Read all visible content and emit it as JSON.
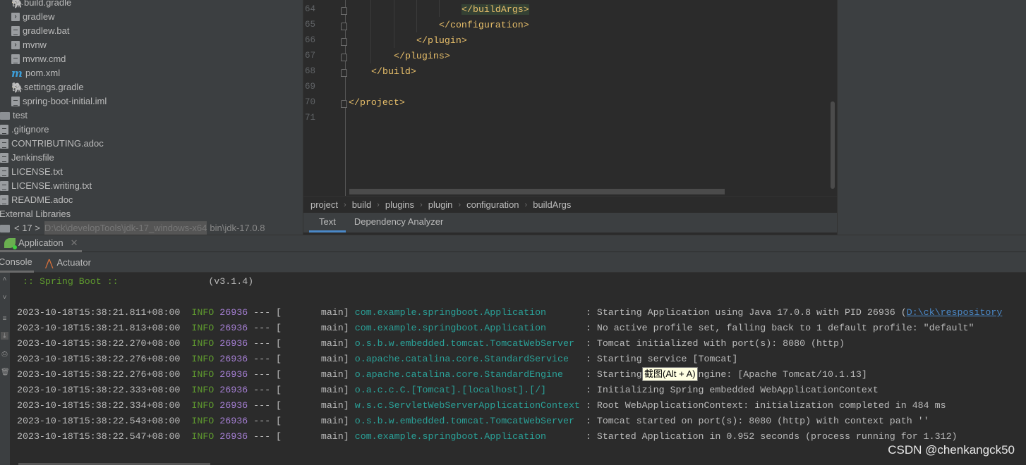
{
  "project_tree": [
    {
      "label": "build.gradle",
      "icon": "gradle-icon",
      "indent": 1
    },
    {
      "label": "gradlew",
      "icon": "executable-icon",
      "indent": 1
    },
    {
      "label": "gradlew.bat",
      "icon": "text-file-icon",
      "indent": 1
    },
    {
      "label": "mvnw",
      "icon": "executable-icon",
      "indent": 1
    },
    {
      "label": "mvnw.cmd",
      "icon": "text-file-icon",
      "indent": 1
    },
    {
      "label": "pom.xml",
      "icon": "maven-icon",
      "indent": 1
    },
    {
      "label": "settings.gradle",
      "icon": "gradle-icon",
      "indent": 1
    },
    {
      "label": "spring-boot-initial.iml",
      "icon": "module-file-icon",
      "indent": 1
    },
    {
      "label": "test",
      "icon": "folder-icon",
      "indent": 0
    },
    {
      "label": ".gitignore",
      "icon": "ignore-file-icon",
      "indent": 0
    },
    {
      "label": "CONTRIBUTING.adoc",
      "icon": "text-file-icon",
      "indent": 0
    },
    {
      "label": "Jenkinsfile",
      "icon": "text-file-icon",
      "indent": 0
    },
    {
      "label": "LICENSE.txt",
      "icon": "text-file-icon",
      "indent": 0
    },
    {
      "label": "LICENSE.writing.txt",
      "icon": "text-file-icon",
      "indent": 0
    },
    {
      "label": "README.adoc",
      "icon": "text-file-icon",
      "indent": 0
    },
    {
      "label": "External Libraries",
      "icon": "",
      "indent": -1
    }
  ],
  "jdk_row": {
    "name": "< 17 >",
    "path": "D:\\ck\\developTools\\jdk-17_windows-x64",
    "suffix": "bin\\jdk-17.0.8"
  },
  "editor": {
    "lines": [
      {
        "num": "64",
        "text": "</buildArgs>",
        "indent": 5,
        "highlight": true
      },
      {
        "num": "65",
        "text": "</configuration>",
        "indent": 4
      },
      {
        "num": "66",
        "text": "</plugin>",
        "indent": 3
      },
      {
        "num": "67",
        "text": "</plugins>",
        "indent": 2
      },
      {
        "num": "68",
        "text": "</build>",
        "indent": 1
      },
      {
        "num": "69",
        "text": "",
        "indent": 0
      },
      {
        "num": "70",
        "text": "</project>",
        "indent": 0
      },
      {
        "num": "71",
        "text": "",
        "indent": 0
      }
    ]
  },
  "breadcrumbs": [
    "project",
    "build",
    "plugins",
    "plugin",
    "configuration",
    "buildArgs"
  ],
  "editor_tabs": [
    {
      "label": "Text",
      "active": true
    },
    {
      "label": "Dependency Analyzer",
      "active": false
    }
  ],
  "run": {
    "tab_label": "Application",
    "sub_tabs": [
      {
        "label": "Console",
        "active": true
      },
      {
        "label": "Actuator",
        "active": false
      }
    ]
  },
  "console": {
    "banner": ":: Spring Boot ::",
    "version": "(v3.1.4)",
    "logs": [
      {
        "ts": "2023-10-18T15:38:21.811+08:00",
        "level": "INFO",
        "pid": "26936",
        "thread": "main",
        "logger": "com.example.springboot.Application",
        "msg": "Starting Application using Java 17.0.8 with PID 26936 (",
        "link": "D:\\ck\\respository"
      },
      {
        "ts": "2023-10-18T15:38:21.813+08:00",
        "level": "INFO",
        "pid": "26936",
        "thread": "main",
        "logger": "com.example.springboot.Application",
        "msg": "No active profile set, falling back to 1 default profile: \"default\""
      },
      {
        "ts": "2023-10-18T15:38:22.270+08:00",
        "level": "INFO",
        "pid": "26936",
        "thread": "main",
        "logger": "o.s.b.w.embedded.tomcat.TomcatWebServer",
        "msg": "Tomcat initialized with port(s): 8080 (http)"
      },
      {
        "ts": "2023-10-18T15:38:22.276+08:00",
        "level": "INFO",
        "pid": "26936",
        "thread": "main",
        "logger": "o.apache.catalina.core.StandardService",
        "msg": "Starting service [Tomcat]"
      },
      {
        "ts": "2023-10-18T15:38:22.276+08:00",
        "level": "INFO",
        "pid": "26936",
        "thread": "main",
        "logger": "o.apache.catalina.core.StandardEngine",
        "msg": "Starting Servlet engine: [Apache Tomcat/10.1.13]"
      },
      {
        "ts": "2023-10-18T15:38:22.333+08:00",
        "level": "INFO",
        "pid": "26936",
        "thread": "main",
        "logger": "o.a.c.c.C.[Tomcat].[localhost].[/]",
        "msg": "Initializing Spring embedded WebApplicationContext"
      },
      {
        "ts": "2023-10-18T15:38:22.334+08:00",
        "level": "INFO",
        "pid": "26936",
        "thread": "main",
        "logger": "w.s.c.ServletWebServerApplicationContext",
        "msg": "Root WebApplicationContext: initialization completed in 484 ms"
      },
      {
        "ts": "2023-10-18T15:38:22.543+08:00",
        "level": "INFO",
        "pid": "26936",
        "thread": "main",
        "logger": "o.s.b.w.embedded.tomcat.TomcatWebServer",
        "msg": "Tomcat started on port(s): 8080 (http) with context path ''"
      },
      {
        "ts": "2023-10-18T15:38:22.547+08:00",
        "level": "INFO",
        "pid": "26936",
        "thread": "main",
        "logger": "com.example.springboot.Application",
        "msg": "Started Application in 0.952 seconds (process running for 1.312)"
      }
    ]
  },
  "tooltip": "截图(Alt + A)",
  "watermark": "CSDN @chenkangck50",
  "colors": {
    "info": "#5f9a2e",
    "pid": "#a57fd3",
    "logger": "#2aa198",
    "tag": "#e8bf6a",
    "link": "#4a88c7"
  }
}
